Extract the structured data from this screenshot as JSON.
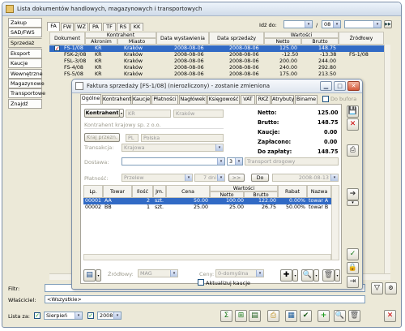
{
  "main": {
    "title": "Lista dokumentów handlowych, magazynowych i transportowych",
    "left_tabs": [
      "Zakup",
      "SAD/FWS",
      "Sprzedaż",
      "Eksport",
      "Kaucje",
      "Wewnętrzne",
      "Magazynowe",
      "Transportowe",
      "Znajdź"
    ],
    "top_tabs": [
      "FA",
      "FW",
      "WZ",
      "PA",
      "TF",
      "RS",
      "KK"
    ],
    "idz_do_label": "Idź do:",
    "idz_do_sep": "/",
    "idz_do_month": "08",
    "columns": {
      "dokument": "Dokument",
      "kontrahent": "Kontrahent",
      "akronim": "Akronim",
      "miasto": "Miasto",
      "data_wystawienia": "Data wystawienia",
      "data_sprzedazy": "Data sprzedaży",
      "wartosci": "Wartości",
      "netto": "Netto",
      "brutto": "Brutto",
      "zrodlowy": "Źródłowy"
    },
    "rows": [
      {
        "doc": "FS-1/08",
        "akr": "KR",
        "miasto": "Kraków",
        "dw": "2008-08-06",
        "ds": "2008-08-06",
        "netto": "125.00",
        "brutto": "148.75",
        "src": ""
      },
      {
        "doc": "FSK-2/08",
        "akr": "KR",
        "miasto": "Kraków",
        "dw": "2008-08-06",
        "ds": "2008-08-06",
        "netto": "-12.50",
        "brutto": "-13.38",
        "src": "FS-1/08"
      },
      {
        "doc": "FSL-3/08",
        "akr": "KR",
        "miasto": "Kraków",
        "dw": "2008-08-06",
        "ds": "2008-08-06",
        "netto": "200.00",
        "brutto": "244.00",
        "src": ""
      },
      {
        "doc": "FS-4/08",
        "akr": "KR",
        "miasto": "Kraków",
        "dw": "2008-08-06",
        "ds": "2008-08-06",
        "netto": "240.00",
        "brutto": "292.80",
        "src": ""
      },
      {
        "doc": "FS-5/08",
        "akr": "KR",
        "miasto": "Kraków",
        "dw": "2008-08-06",
        "ds": "2008-08-06",
        "netto": "175.00",
        "brutto": "213.50",
        "src": ""
      }
    ],
    "filtr_label": "Filtr:",
    "wlasciciel_label": "Właściciel:",
    "wlasciciel_value": "<Wszystkie>",
    "lista_za_label": "Lista za:",
    "lista_month": "Sierpień",
    "lista_year": "2008"
  },
  "dialog": {
    "title": "Faktura sprzedaży [FS-1/08] (nierozliczony) - zostanie zmieniona",
    "tabs": [
      "Ogólne",
      "Kontrahent",
      "Kaucje",
      "Płatności",
      "Nagłówek",
      "Księgowość",
      "VAT",
      "RKZ",
      "Atrybuty",
      "Biname"
    ],
    "do_bufora": "Do bufora",
    "kontrahent_btn": "Kontrahent",
    "kontrahent_code": "KR",
    "kontrahent_city": "Kraków",
    "kontrahent_name": "Kontrahent krajowy sp. z o.o.",
    "kraj_btn": "Kraj przezn.",
    "kraj_code": "PL",
    "kraj_name": "Polska",
    "transakcja_label": "Transakcja:",
    "transakcja_value": "Krajowa",
    "dostawa_label": "Dostawa:",
    "dostawa_num": "3",
    "dostawa_value": "Transport drogowy",
    "platnosc_label": "Płatność:",
    "platnosc_value": "Przelew",
    "platnosc_dni": "7 dni",
    "do_btn": "Do",
    "termin": "2008-08-13",
    "sums": [
      {
        "label": "Netto:",
        "value": "125.00"
      },
      {
        "label": "Brutto:",
        "value": "148.75"
      },
      {
        "label": "Kaucje:",
        "value": "0.00"
      },
      {
        "label": "Zapłacono:",
        "value": "0.00"
      },
      {
        "label": "Do zapłaty:",
        "value": "148.75"
      }
    ],
    "grid_cols": {
      "lp": "Lp.",
      "towar": "Towar",
      "ilosc": "Ilość",
      "jm": "Jm.",
      "cena": "Cena",
      "wartosci": "Wartości",
      "netto": "Netto",
      "brutto": "Brutto",
      "rabat": "Rabat",
      "nazwa": "Nazwa"
    },
    "grid_rows": [
      {
        "lp": "00001",
        "towar": "AA",
        "ilosc": "2",
        "jm": "szt.",
        "cena": "50.00",
        "netto": "100.00",
        "brutto": "122.00",
        "rabat": "0.00%",
        "nazwa": "towar A"
      },
      {
        "lp": "00002",
        "towar": "BB",
        "ilosc": "1",
        "jm": "szt.",
        "cena": "25.00",
        "netto": "25.00",
        "brutto": "26.75",
        "rabat": "50.00%",
        "nazwa": "towar B"
      }
    ],
    "zrodlowy_label": "Źródłowy:",
    "zrodlowy_value": "MAG",
    "ceny_label": "Ceny:",
    "ceny_value": "0-domyślna",
    "aktualizuj_label": "Aktualizuj kaucje"
  }
}
